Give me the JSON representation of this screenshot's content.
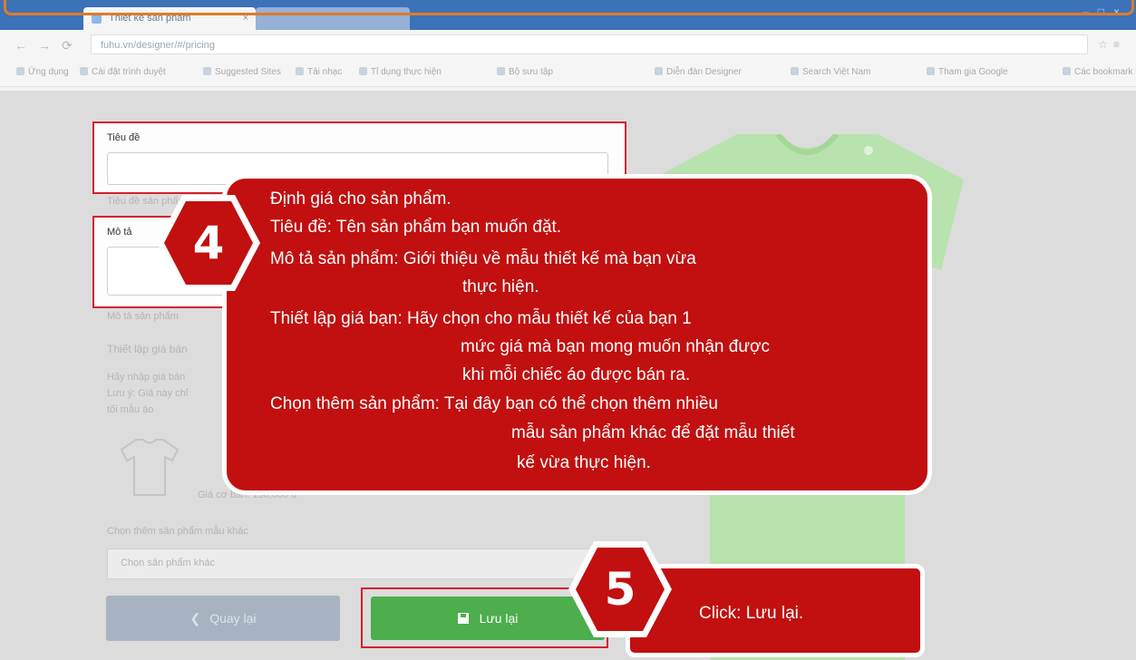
{
  "browser": {
    "tab_title": "Thiết kế sản phẩm",
    "address": "fuhu.vn/designer/#/pricing",
    "bookmarks": [
      "Ứng dụng",
      "Cài đặt trình duyệt",
      "Suggested Sites",
      "Tải nhạc",
      "Tỉ dụng thực hiện",
      "Bộ sưu tập",
      "Diễn đàn Designer",
      "Search Việt Nam",
      "Tham gia Google",
      "Các bookmark khác"
    ]
  },
  "form": {
    "title_label": "Tiêu đề",
    "title_helper": "Tiêu đề sản phẩm",
    "desc_label": "Mô tả",
    "desc_helper": "Mô tả sản phẩm",
    "price_label": "Thiết lập giá bán",
    "price_hint_1": "Hãy nhập giá bán",
    "price_hint_2": "Lưu ý: Giá này chỉ",
    "price_hint_3": "tổi mẫu áo",
    "base_price": "Giá cơ bản: 150,000 đ",
    "more_products_label": "Chọn thêm sản phẩm mẫu khác",
    "more_products_placeholder": "Chọn sản phẩm khác",
    "back_label": "Quay lại",
    "save_label": "Lưu lại"
  },
  "tutorial": {
    "step4_number": "4",
    "step4_lines": [
      "Định giá cho sản phẩm.",
      "Tiêu đề: Tên sản phẩm bạn muốn đặt.",
      "Mô tả sản phẩm:  Giới thiệu về mẫu thiết kế mà bạn vừa",
      "thực hiện.",
      "Thiết lập giá bạn: Hãy chọn cho mẫu thiết kế của bạn 1",
      "mức giá mà bạn mong muốn nhận được",
      "khi mỗi chiếc áo được bán ra.",
      "Chọn thêm sản phẩm: Tại đây bạn có thể chọn thêm nhiều",
      "mẫu sản phẩm khác để đặt mẫu thiết",
      "kế vừa thực hiện."
    ],
    "step5_number": "5",
    "step5_text": "Click: Lưu lại."
  },
  "colors": {
    "callout_red": "#c20f0f",
    "frame_red": "#d6202a",
    "save_green": "#4cae4c",
    "shirt_green": "#b8e2ae",
    "outline_orange": "#e07a2a"
  }
}
